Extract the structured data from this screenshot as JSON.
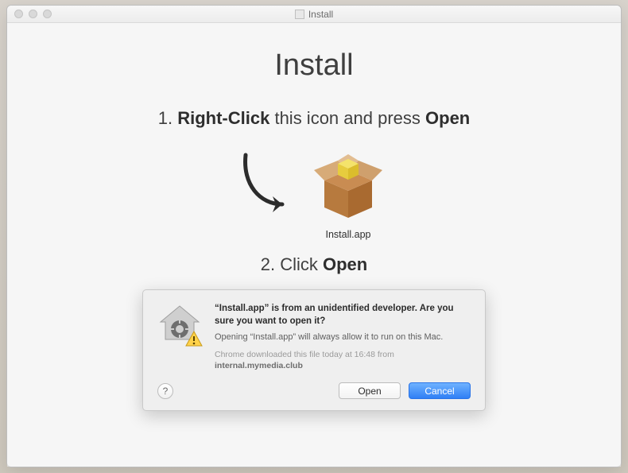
{
  "window": {
    "title": "Install"
  },
  "content": {
    "heading": "Install",
    "step1_prefix": "1. ",
    "step1_bold1": "Right-Click",
    "step1_mid": " this icon and press ",
    "step1_bold2": "Open",
    "package_label": "Install.app",
    "step2_prefix": "2. Click ",
    "step2_bold": "Open"
  },
  "dialog": {
    "headline": "“Install.app” is from an unidentified developer. Are you sure you want to open it?",
    "sub": "Opening “Install.app” will always allow it to run on this Mac.",
    "source_prefix": "Chrome downloaded this file today at 16:48 from ",
    "source_domain": "internal.mymedia.club",
    "help_label": "?",
    "open_label": "Open",
    "cancel_label": "Cancel"
  }
}
